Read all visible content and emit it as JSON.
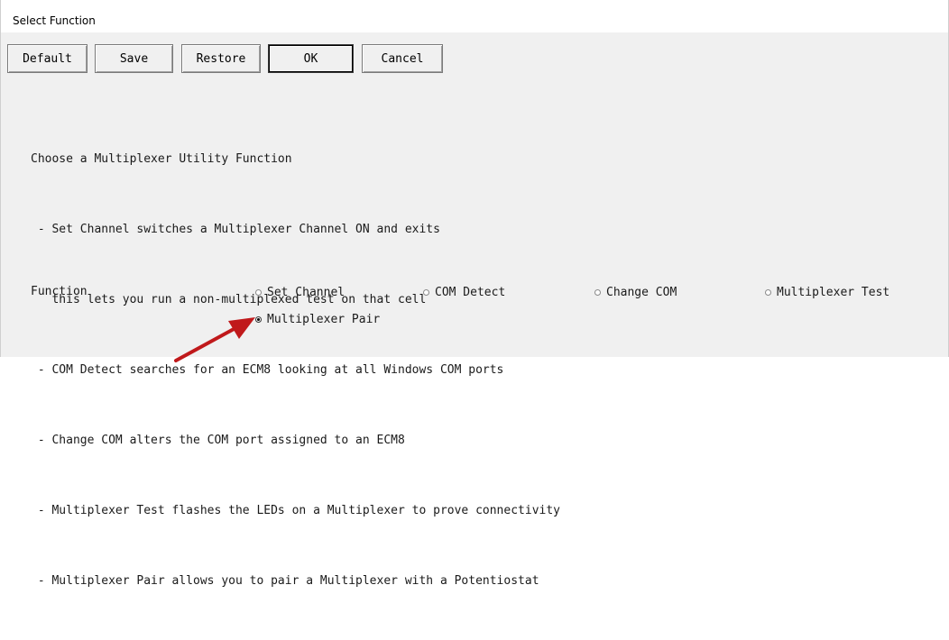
{
  "window": {
    "title": "Select Function"
  },
  "toolbar": {
    "buttons": [
      {
        "label": "Default"
      },
      {
        "label": "Save"
      },
      {
        "label": "Restore"
      },
      {
        "label": "OK"
      },
      {
        "label": "Cancel"
      }
    ]
  },
  "description": {
    "lines": [
      "Choose a Multiplexer Utility Function",
      " - Set Channel switches a Multiplexer Channel ON and exits",
      "   this lets you run a non-multiplexed test on that cell",
      " - COM Detect searches for an ECM8 looking at all Windows COM ports",
      " - Change COM alters the COM port assigned to an ECM8",
      " - Multiplexer Test flashes the LEDs on a Multiplexer to prove connectivity",
      " - Multiplexer Pair allows you to pair a Multiplexer with a Potentiostat"
    ]
  },
  "function": {
    "label": "Function",
    "options": [
      {
        "label": "Set Channel",
        "checked": false
      },
      {
        "label": "COM Detect",
        "checked": false
      },
      {
        "label": "Change COM",
        "checked": false
      },
      {
        "label": "Multiplexer Test",
        "checked": false
      },
      {
        "label": "Multiplexer Pair",
        "checked": true
      }
    ]
  },
  "annotation": {
    "arrow_color": "#c0191b"
  }
}
